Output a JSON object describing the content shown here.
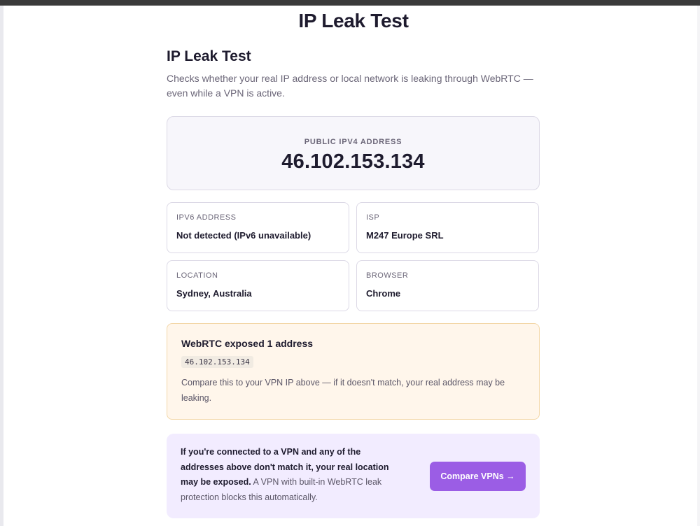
{
  "page": {
    "title": "IP Leak Test"
  },
  "section": {
    "heading": "IP Leak Test",
    "description": "Checks whether your real IP address or local network is leaking through WebRTC — even while a VPN is active."
  },
  "public_ip": {
    "label": "PUBLIC IPV4 ADDRESS",
    "value": "46.102.153.134"
  },
  "details": [
    {
      "label": "IPV6 ADDRESS",
      "value": "Not detected (IPv6 unavailable)"
    },
    {
      "label": "ISP",
      "value": "M247 Europe SRL"
    },
    {
      "label": "LOCATION",
      "value": "Sydney, Australia"
    },
    {
      "label": "BROWSER",
      "value": "Chrome"
    }
  ],
  "webrtc": {
    "title": "WebRTC exposed 1 address",
    "address": "46.102.153.134",
    "note": "Compare this to your VPN IP above — if it doesn't match, your real address may be leaking."
  },
  "cta": {
    "bold_text": "If you're connected to a VPN and any of the addresses above don't match it, your real location may be exposed.",
    "text": " A VPN with built-in WebRTC leak protection blocks this automatically.",
    "button_label": "Compare VPNs →"
  },
  "colors": {
    "accent": "#9b5de5",
    "warning_bg": "#fff6eb",
    "cta_bg": "#f2ecff"
  }
}
